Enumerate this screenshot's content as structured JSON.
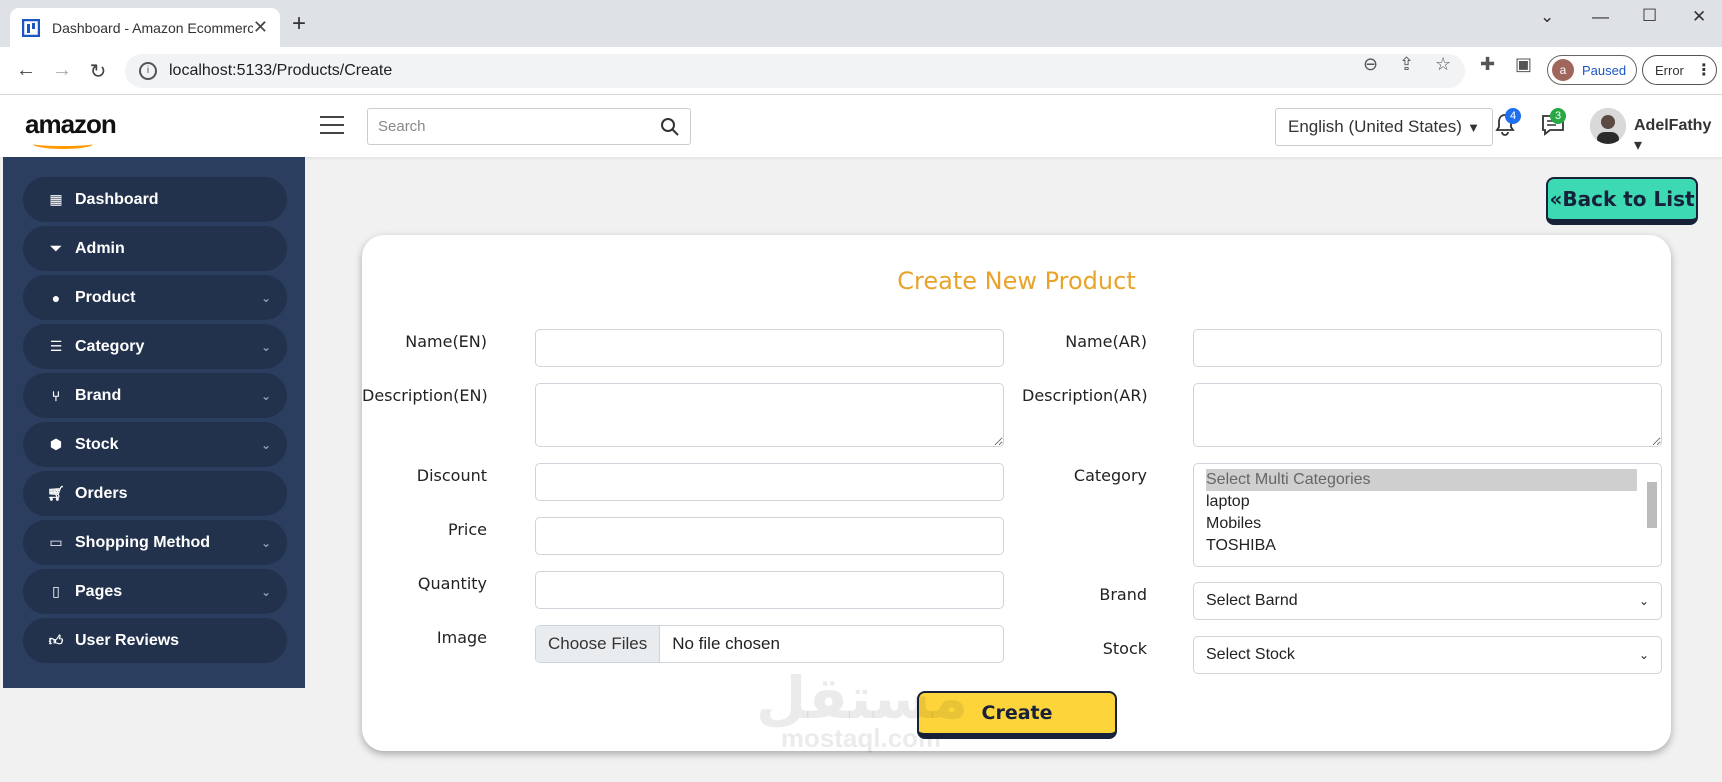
{
  "browser": {
    "tab_title": "Dashboard - Amazon Ecommerce",
    "url_host": "localhost",
    "url_rest": ":5133/Products/Create",
    "profile_initial": "a",
    "profile_status": "Paused",
    "error_label": "Error"
  },
  "header": {
    "logo": "amazon",
    "search_placeholder": "Search",
    "language": "English (United States)",
    "notifications_count": "4",
    "messages_count": "3",
    "username": "AdelFathy"
  },
  "sidebar": {
    "items": [
      {
        "label": "Dashboard",
        "icon": "grid-icon"
      },
      {
        "label": "Admin",
        "icon": "filter-icon"
      },
      {
        "label": "Product",
        "icon": "product-icon"
      },
      {
        "label": "Category",
        "icon": "list-icon"
      },
      {
        "label": "Brand",
        "icon": "branch-icon"
      },
      {
        "label": "Stock",
        "icon": "cubes-icon"
      },
      {
        "label": "Orders",
        "icon": "cart-icon"
      },
      {
        "label": "Shopping Method",
        "icon": "credit-card-icon"
      },
      {
        "label": "Pages",
        "icon": "file-icon"
      },
      {
        "label": "User Reviews",
        "icon": "thumbs-up-icon"
      }
    ]
  },
  "actions": {
    "back_to_list": "Back to List",
    "create": "Create"
  },
  "form": {
    "title": "Create New Product",
    "name_en_label": "Name(EN)",
    "name_ar_label": "Name(AR)",
    "desc_en_label": "Description(EN)",
    "desc_ar_label": "Description(AR)",
    "discount_label": "Discount",
    "category_label": "Category",
    "price_label": "Price",
    "quantity_label": "Quantity",
    "brand_label": "Brand",
    "image_label": "Image",
    "stock_label": "Stock",
    "choose_files": "Choose Files",
    "no_file": "No file chosen",
    "categories": [
      "Select Multi Categories",
      "laptop",
      "Mobiles",
      "TOSHIBA"
    ],
    "brand_value": "Select Barnd",
    "stock_value": "Select Stock"
  },
  "watermark": {
    "arabic": "مستقل",
    "latin": "mostaql.com"
  }
}
